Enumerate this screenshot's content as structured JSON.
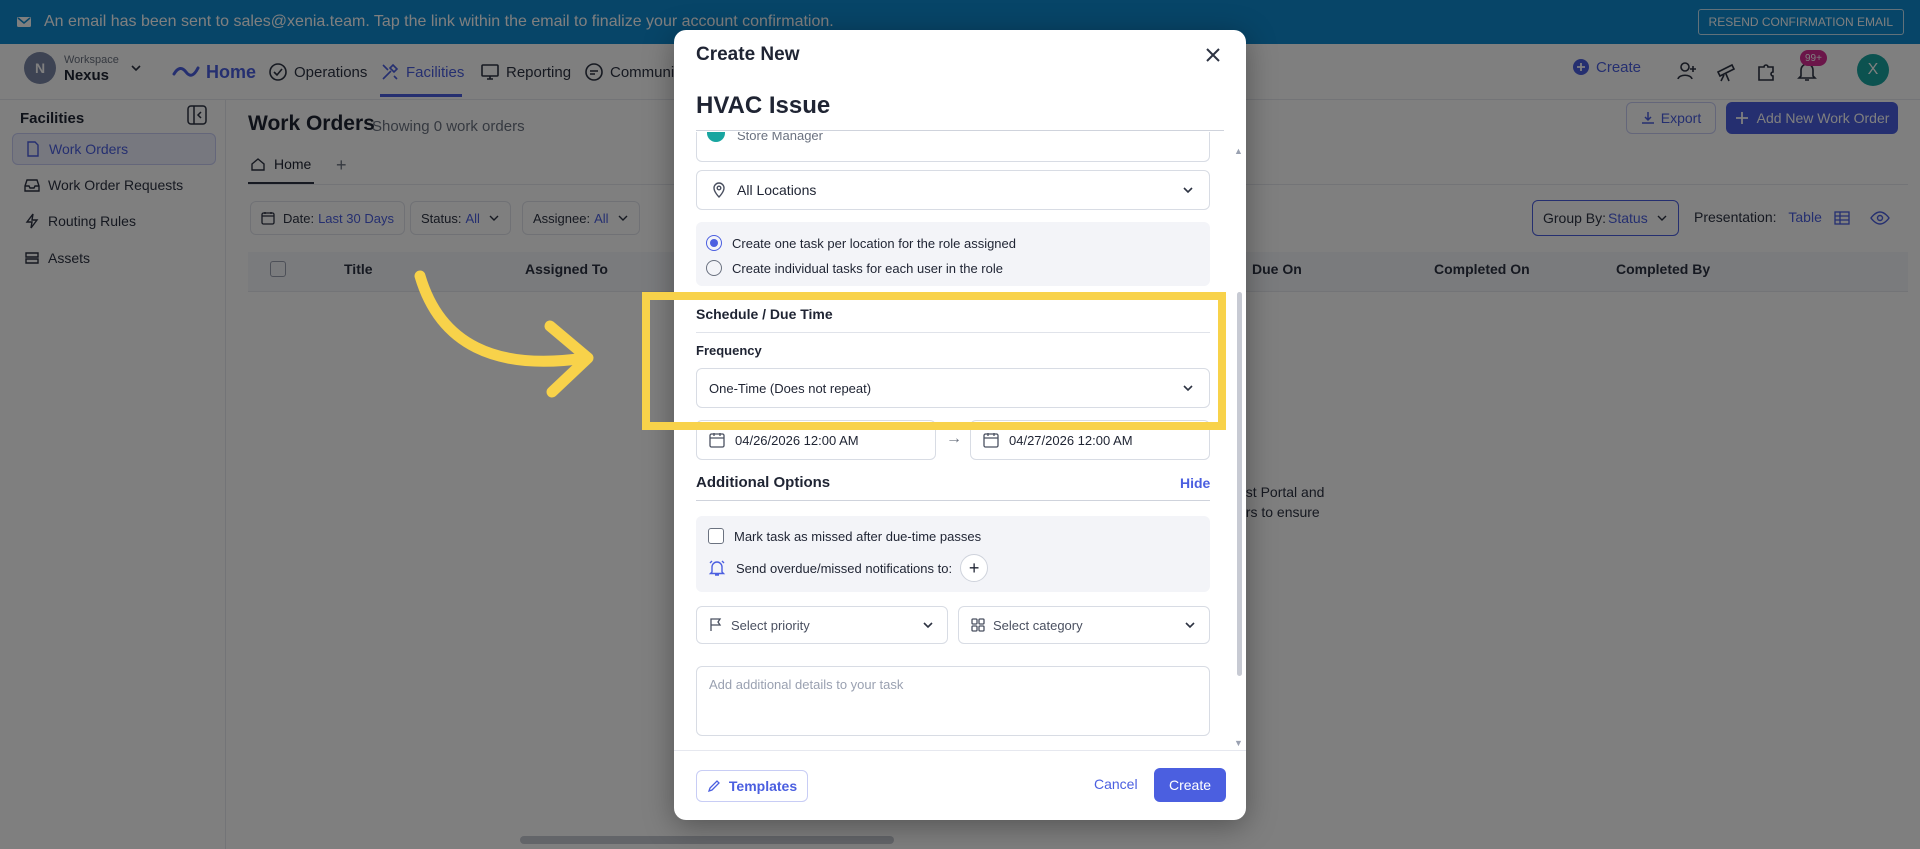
{
  "banner": {
    "message": "An email has been sent to sales@xenia.team. Tap the link within the email to finalize your account confirmation.",
    "resend_label": "RESEND CONFIRMATION EMAIL"
  },
  "workspace": {
    "label": "Workspace",
    "name": "Nexus",
    "initial": "N"
  },
  "nav": {
    "home": "Home",
    "operations": "Operations",
    "facilities": "Facilities",
    "reporting": "Reporting",
    "communication": "Communi",
    "create": "Create",
    "notif_badge": "99+",
    "user_initial": "X"
  },
  "sidebar": {
    "title": "Facilities",
    "items": [
      {
        "label": "Work Orders"
      },
      {
        "label": "Work Order Requests"
      },
      {
        "label": "Routing Rules"
      },
      {
        "label": "Assets"
      }
    ]
  },
  "main": {
    "title": "Work Orders",
    "subtitle": "Showing 0 work orders",
    "export_label": "Export",
    "add_label": "Add New Work Order",
    "tab_home": "Home",
    "tab_add": "+",
    "filters": {
      "date_label": "Date:",
      "date_value": "Last 30 Days",
      "status_label": "Status:",
      "status_value": "All",
      "assignee_label": "Assignee:",
      "assignee_value": "All"
    },
    "group_by_label": "Group By:",
    "group_by_value": "Status",
    "presentation_label": "Presentation:",
    "presentation_value": "Table",
    "columns": [
      "Title",
      "Assigned To",
      "Due On",
      "Completed On",
      "Completed By"
    ],
    "empty_line1": "est Portal and",
    "empty_line2": "ers to ensure"
  },
  "modal": {
    "header": "Create New",
    "task_name": "HVAC Issue",
    "role_partial": "Store Manager",
    "location": "All Locations",
    "radio_one": "Create one task per location for the role assigned",
    "radio_two": "Create individual tasks for each user in the role",
    "schedule_title": "Schedule / Due Time",
    "frequency_label": "Frequency",
    "frequency_value": "One-Time (Does not repeat)",
    "start_date": "04/26/2026 12:00 AM",
    "end_date": "04/27/2026 12:00 AM",
    "additional_title": "Additional Options",
    "hide_label": "Hide",
    "missed_label": "Mark task as missed after due-time passes",
    "notify_label": "Send overdue/missed notifications to:",
    "priority_placeholder": "Select priority",
    "category_placeholder": "Select category",
    "details_placeholder": "Add additional details to your task",
    "templates_label": "Templates",
    "cancel_label": "Cancel",
    "create_label": "Create"
  },
  "colors": {
    "banner": "#0f8ad1",
    "accent": "#4b5fe0",
    "highlight": "#f8d24a",
    "overlay": "rgba(0,0,0,0.5)"
  }
}
